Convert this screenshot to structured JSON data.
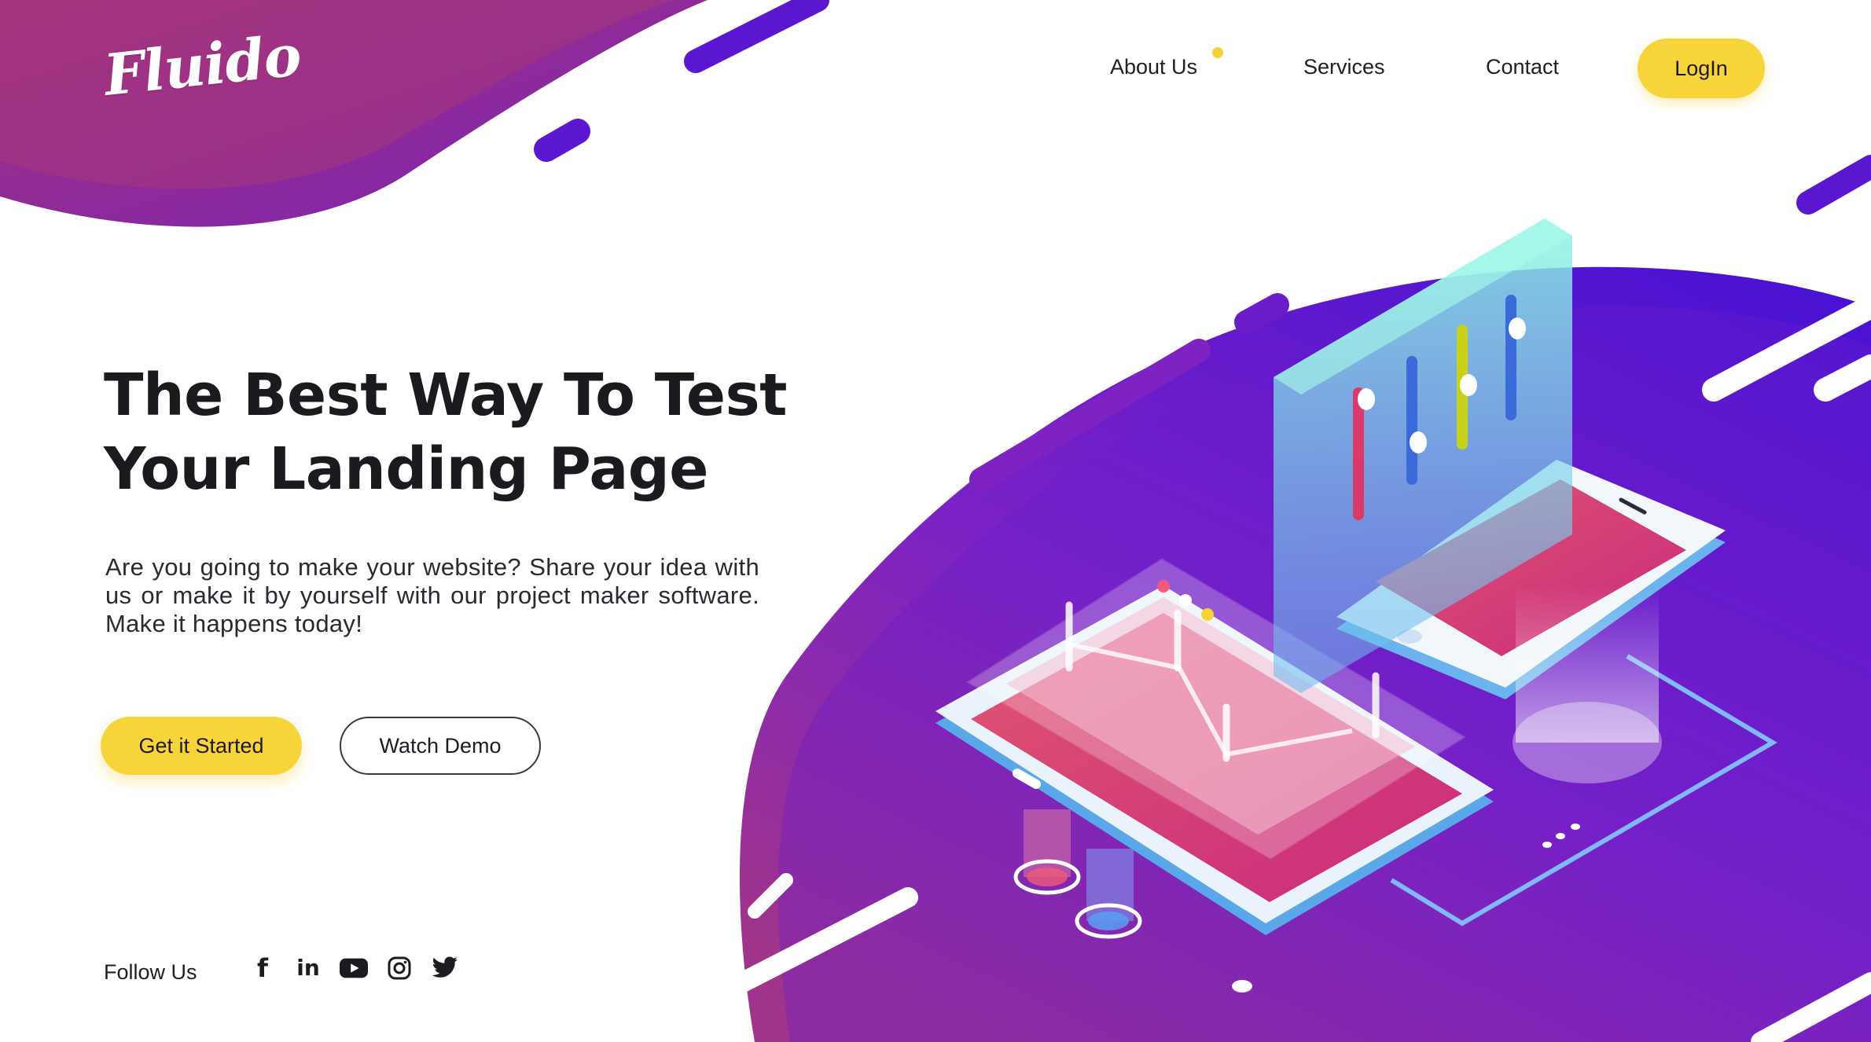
{
  "brand": {
    "logo_text": "Fluido"
  },
  "nav": {
    "items": [
      "About Us",
      "Services",
      "Contact"
    ],
    "login_label": "LogIn"
  },
  "hero": {
    "title_line1": "The Best Way To Test",
    "title_line2": "Your Landing Page",
    "description": "Are you going to make your website? Share your idea with us or make it by yourself with our project maker software. Make it happens today!",
    "primary_cta": "Get it Started",
    "secondary_cta": "Watch Demo"
  },
  "social": {
    "label": "Follow Us",
    "icons": [
      "facebook-icon",
      "linkedin-icon",
      "youtube-icon",
      "instagram-icon",
      "twitter-icon"
    ]
  },
  "colors": {
    "accent_yellow": "#f8d43b",
    "purple_dark": "#5a18c9",
    "magenta": "#a33384",
    "text_dark": "#1b1a1f"
  }
}
